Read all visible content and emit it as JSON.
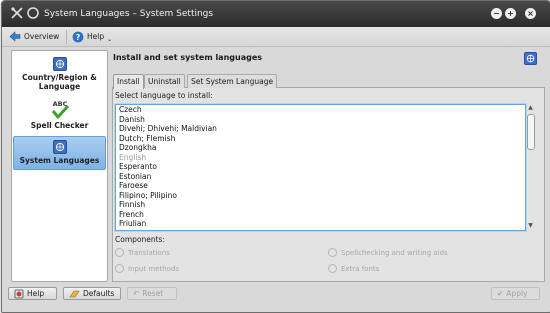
{
  "window": {
    "title": "System Languages – System Settings"
  },
  "toolbar": {
    "overview_label": "Overview",
    "help_label": "Help"
  },
  "sidebar": {
    "items": [
      {
        "label": "Country/Region & Language",
        "icon": "flag-globe-icon"
      },
      {
        "label": "Spell Checker",
        "icon": "spell-check-icon"
      },
      {
        "label": "System Languages",
        "icon": "flag-globe-icon"
      }
    ],
    "active_index": 2
  },
  "panel": {
    "header": "Install and set system languages",
    "tabs": [
      "Install",
      "Uninstall",
      "Set System Language"
    ],
    "active_tab": 0,
    "select_label": "Select language to install:",
    "languages": [
      {
        "name": "Czech",
        "dim": false
      },
      {
        "name": "Danish",
        "dim": false
      },
      {
        "name": "Divehi; Dhivehi; Maldivian",
        "dim": false
      },
      {
        "name": "Dutch; Flemish",
        "dim": false
      },
      {
        "name": "Dzongkha",
        "dim": false
      },
      {
        "name": "English",
        "dim": true
      },
      {
        "name": "Esperanto",
        "dim": false
      },
      {
        "name": "Estonian",
        "dim": false
      },
      {
        "name": "Faroese",
        "dim": false
      },
      {
        "name": "Filipino; Pilipino",
        "dim": false
      },
      {
        "name": "Finnish",
        "dim": false
      },
      {
        "name": "French",
        "dim": false
      },
      {
        "name": "Friulian",
        "dim": false
      }
    ],
    "components_label": "Components:",
    "components": [
      {
        "label": "Translations",
        "checked": false,
        "enabled": false
      },
      {
        "label": "Spellchecking and writing aids",
        "checked": false,
        "enabled": false
      },
      {
        "label": "Input methods",
        "checked": false,
        "enabled": false
      },
      {
        "label": "Extra fonts",
        "checked": false,
        "enabled": false
      }
    ]
  },
  "buttons": {
    "help": "Help",
    "defaults": "Defaults",
    "reset": "Reset",
    "apply": "Apply"
  },
  "colors": {
    "selection": "#7eb3e6",
    "list_focus": "#6aa3db",
    "titlebar": "#2b2b2b"
  }
}
